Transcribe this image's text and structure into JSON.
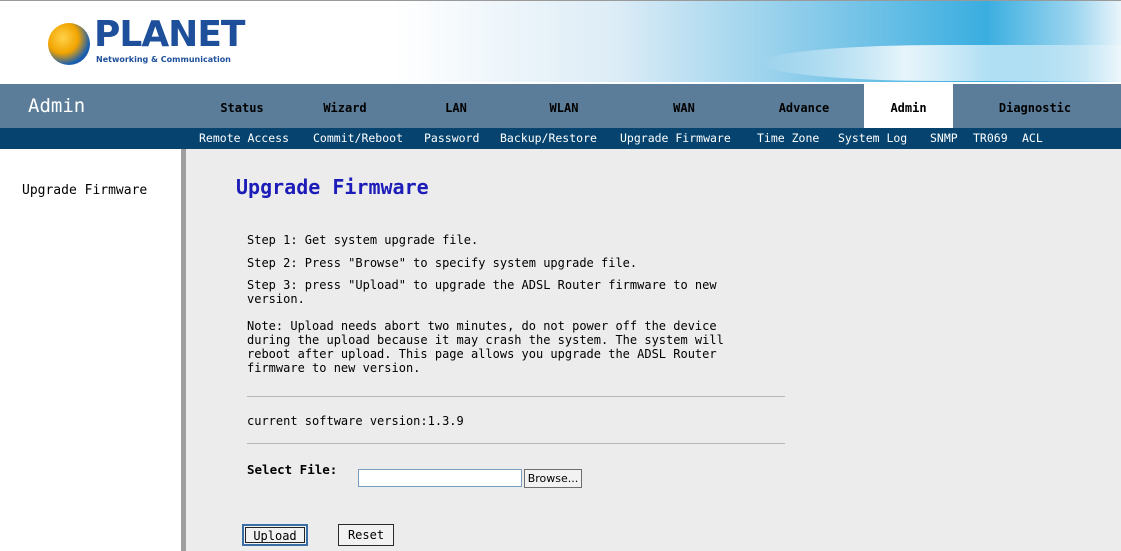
{
  "brand": {
    "logo_text": "PLANET",
    "tagline": "Networking & Communication"
  },
  "header": {
    "section_title": "Admin"
  },
  "main_nav": [
    {
      "label": "Status",
      "active": false
    },
    {
      "label": "Wizard",
      "active": false
    },
    {
      "label": "LAN",
      "active": false
    },
    {
      "label": "WLAN",
      "active": false
    },
    {
      "label": "WAN",
      "active": false
    },
    {
      "label": "Advance",
      "active": false
    },
    {
      "label": "Admin",
      "active": true
    },
    {
      "label": "Diagnostic",
      "active": false
    }
  ],
  "sub_nav": [
    {
      "label": "Remote Access"
    },
    {
      "label": "Commit/Reboot"
    },
    {
      "label": "Password"
    },
    {
      "label": "Backup/Restore"
    },
    {
      "label": "Upgrade Firmware"
    },
    {
      "label": "Time Zone"
    },
    {
      "label": "System Log"
    },
    {
      "label": "SNMP"
    },
    {
      "label": "TR069"
    },
    {
      "label": "ACL"
    }
  ],
  "sidebar": {
    "items": [
      {
        "label": "Upgrade Firmware"
      }
    ]
  },
  "content": {
    "title": "Upgrade Firmware",
    "step1": "Step 1: Get system upgrade file.",
    "step2": "Step 2: Press \"Browse\" to specify system upgrade file.",
    "step3": "Step 3: press \"Upload\" to upgrade the ADSL Router firmware to new version.",
    "note": "Note: Upload needs abort two minutes, do not power off the device during the upload because it may crash the system. The system will reboot after upload. This page allows you upgrade the ADSL Router firmware to new version.",
    "version_text": "current software version:1.3.9",
    "select_file_label": "Select File:",
    "file_value": "",
    "browse_label": "Browse...",
    "upload_label": "Upload",
    "reset_label": "Reset"
  },
  "colors": {
    "nav_bg": "#5b7d99",
    "subnav_bg": "#06446f",
    "title_blue": "#1c1cb8",
    "content_bg": "#ececec"
  }
}
